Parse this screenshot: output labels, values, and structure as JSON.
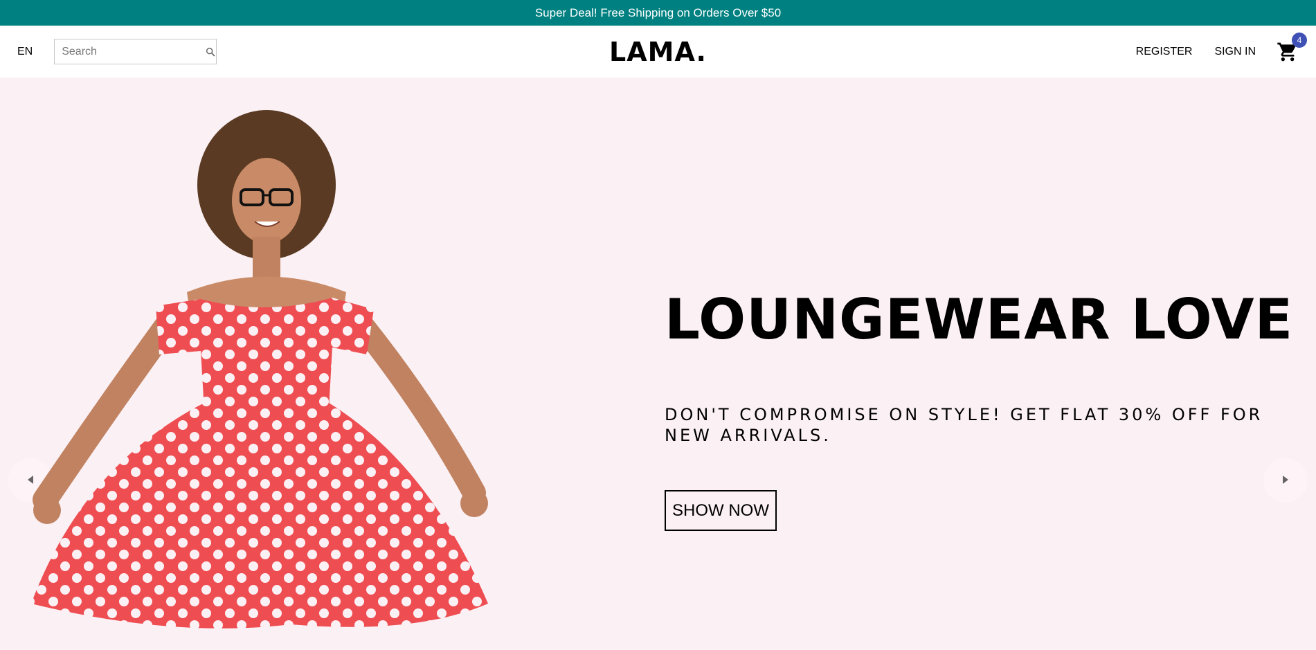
{
  "announcement": {
    "text": "Super Deal! Free Shipping on Orders Over $50"
  },
  "navbar": {
    "language": "EN",
    "search_placeholder": "Search",
    "logo": "LAMA.",
    "register": "REGISTER",
    "signin": "SIGN IN",
    "cart_count": "4"
  },
  "slide": {
    "title": "LOUNGEWEAR LOVE",
    "description": "DON'T COMPROMISE ON STYLE! GET FLAT 30% OFF FOR NEW ARRIVALS.",
    "button": "SHOW NOW"
  },
  "colors": {
    "announcement_bg": "#008080",
    "slide_bg": "#fbf0f4",
    "badge_bg": "#3f51b5",
    "dress": "#ee4e52"
  }
}
